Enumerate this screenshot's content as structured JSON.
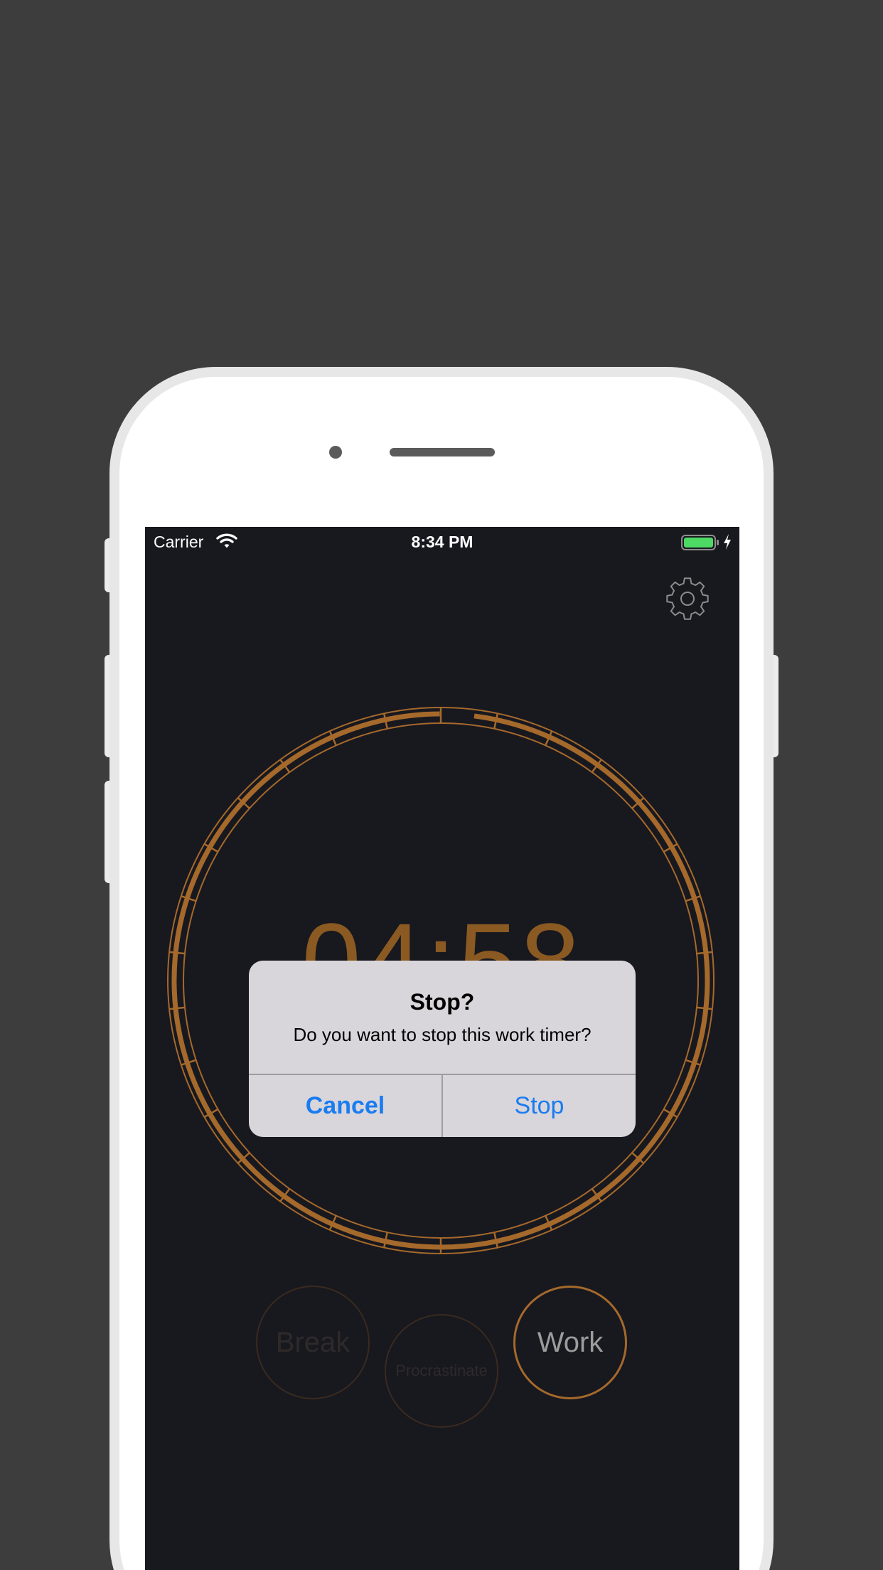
{
  "status_bar": {
    "carrier": "Carrier",
    "time": "8:34 PM",
    "battery_color": "#4cd964"
  },
  "icons": {
    "settings": "gear-icon",
    "wifi": "wifi-icon",
    "battery": "battery-icon",
    "charging": "charging-bolt-icon"
  },
  "timer": {
    "display": "04:58",
    "progress_remaining": 0.98,
    "ring_color": "#a5692b"
  },
  "modes": {
    "break_label": "Break",
    "procrastinate_label": "Procrastinate",
    "work_label": "Work",
    "active": "Work"
  },
  "alert": {
    "title": "Stop?",
    "message": "Do you want to stop this work timer?",
    "cancel_label": "Cancel",
    "stop_label": "Stop",
    "button_color": "#1a7cf0"
  },
  "colors": {
    "page_background": "#3d3d3d",
    "screen_background": "#18181f",
    "accent": "#a5692b"
  }
}
